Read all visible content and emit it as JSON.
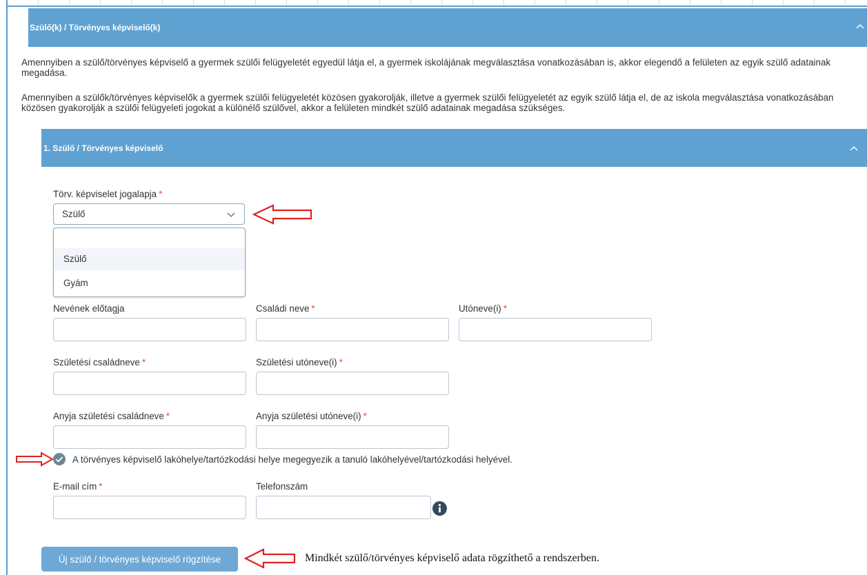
{
  "outer_section": {
    "title": "Szülő(k) / Törvényes képviselő(k)",
    "paragraph1": "Amennyiben a szülő/törvényes képviselő a gyermek szülői felügyeletét egyedül látja el, a gyermek iskolájának megválasztása vonatkozásában is, akkor elegendő a felületen az egyik szülő adatainak megadása.",
    "paragraph2": "Amennyiben a szülők/törvényes képviselők a gyermek szülői felügyeletét közösen gyakorolják, illetve a gyermek szülői felügyeletét az egyik szülő látja el, de az iskola megválasztása vonatkozásában közösen gyakorolják a szülői felügyeleti jogokat a különélő szülővel, akkor a felületen mindkét szülő adatainak megadása szükséges."
  },
  "inner_section": {
    "title": "1. Szülő / Törvényes képviselő"
  },
  "form": {
    "legal_basis_label": "Törv. képviselet jogalapja",
    "legal_basis_value": "Szülő",
    "legal_basis_options": [
      "",
      "Szülő",
      "Gyám"
    ],
    "required_mark": "*",
    "name_prefix_label": "Nevének előtagja",
    "family_name_label": "Családi neve",
    "given_name_label": "Utóneve(i)",
    "birth_family_name_label": "Születési családneve",
    "birth_given_name_label": "Születési utóneve(i)",
    "mother_family_name_label": "Anyja születési családneve",
    "mother_given_name_label": "Anyja születési utóneve(i)",
    "same_address_checkbox_label": "A törvényes képviselő lakóhelye/tartózkodási helye megegyezik a tanuló lakóhelyével/tartózkodási helyével.",
    "same_address_checked": true,
    "email_label": "E-mail cím",
    "phone_label": "Telefonszám"
  },
  "actions": {
    "add_parent_button": "Új szülő / törvényes képviselő rögzítése"
  },
  "annotation_note": "Mindkét szülő/törvényes képviselő adata rögzíthető a rendszerben.",
  "colors": {
    "header_blue": "#5fa2d1",
    "button_blue": "#6ea8d6",
    "required_red": "#d9534f",
    "annotation_arrow_red": "#e02020"
  },
  "icons": {
    "collapse": "chevron-up-icon",
    "dropdown": "chevron-down-icon",
    "info": "info-icon",
    "checkbox": "checkmark-icon",
    "annotation": "red-arrow-icon"
  }
}
